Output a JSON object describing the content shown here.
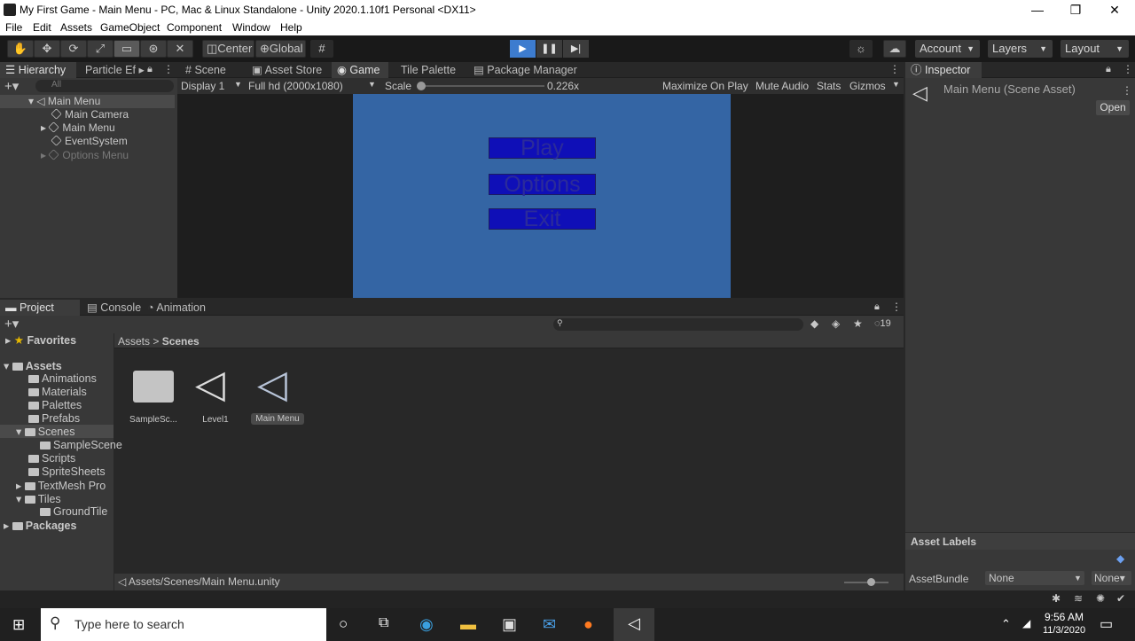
{
  "window": {
    "title": "My First Game - Main Menu - PC, Mac & Linux Standalone - Unity 2020.1.10f1 Personal <DX11>"
  },
  "menu": [
    "File",
    "Edit",
    "Assets",
    "GameObject",
    "Component",
    "Window",
    "Help"
  ],
  "toolbar": {
    "pivot": "Center",
    "space": "Global",
    "account": "Account",
    "layers": "Layers",
    "layout": "Layout"
  },
  "hierarchy": {
    "tab": "Hierarchy",
    "tab2": "Particle Ef",
    "search_placeholder": "All",
    "scene": "Main Menu",
    "items": [
      "Main Camera",
      "Main Menu",
      "EventSystem",
      "Options Menu"
    ]
  },
  "center_tabs": [
    "Scene",
    "Asset Store",
    "Game",
    "Tile Palette",
    "Package Manager"
  ],
  "game_toolbar": {
    "display": "Display 1",
    "resolution": "Full hd (2000x1080)",
    "scale_label": "Scale",
    "scale_value": "0.226x",
    "maximize": "Maximize On Play",
    "mute": "Mute Audio",
    "stats": "Stats",
    "gizmos": "Gizmos"
  },
  "game_view": {
    "bg": "#3465a4",
    "buttons": [
      "Play",
      "Options",
      "Exit"
    ]
  },
  "inspector": {
    "tab": "Inspector",
    "title": "Main Menu (Scene Asset)",
    "open": "Open",
    "asset_labels": "Asset Labels",
    "assetbundle": "AssetBundle",
    "bundle_value": "None",
    "bundle_variant": "None"
  },
  "bottom_tabs": [
    "Project",
    "Console",
    "Animation"
  ],
  "project": {
    "hidden_count": "19",
    "breadcrumb": [
      "Assets",
      "Scenes"
    ],
    "favorites": "Favorites",
    "assets": "Assets",
    "tree": [
      "Animations",
      "Materials",
      "Palettes",
      "Prefabs",
      "Scenes",
      "SampleScene",
      "Scripts",
      "SpriteSheets",
      "TextMesh Pro",
      "Tiles",
      "GroundTile"
    ],
    "packages": "Packages",
    "files": [
      "SampleSc...",
      "Level1",
      "Main Menu"
    ],
    "path": "Assets/Scenes/Main Menu.unity"
  },
  "taskbar": {
    "search": "Type here to search",
    "time": "9:56 AM",
    "date": "11/3/2020"
  }
}
